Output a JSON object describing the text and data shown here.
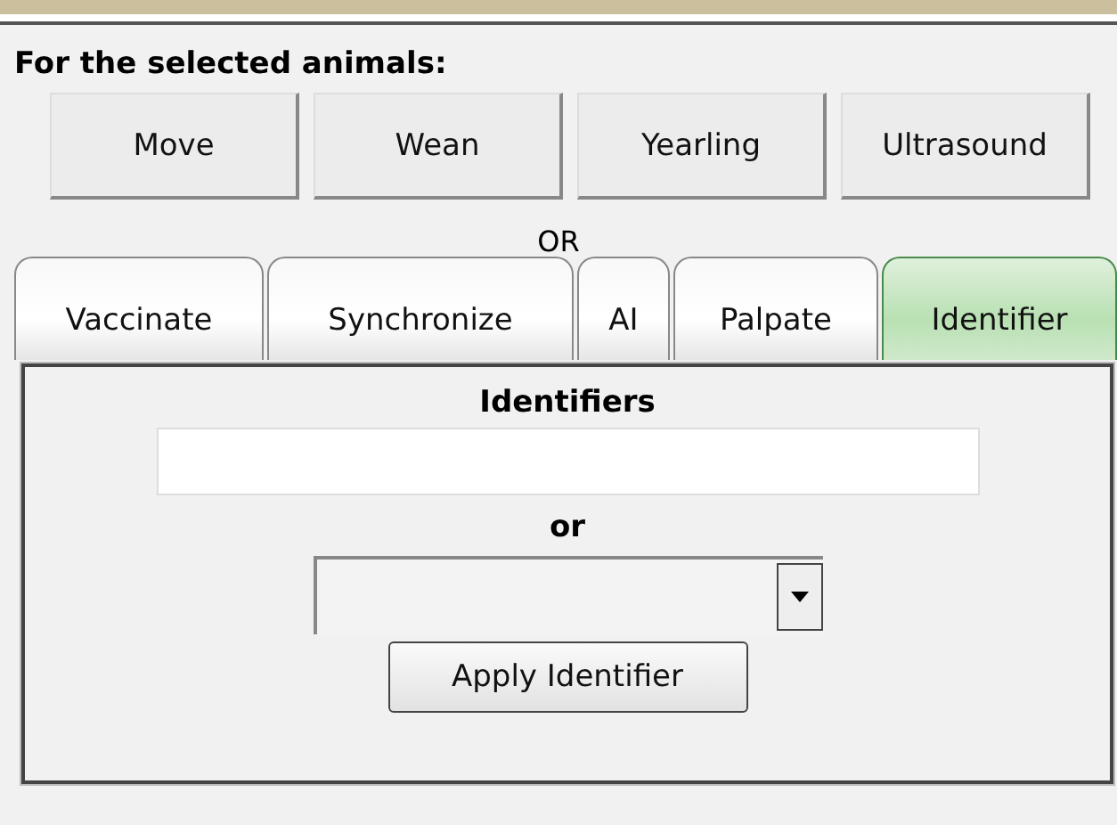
{
  "heading": "For the selected animals:",
  "actions": [
    "Move",
    "Wean",
    "Yearling",
    "Ultrasound"
  ],
  "separator": "OR",
  "tabs": [
    {
      "label": "Vaccinate",
      "selected": false
    },
    {
      "label": "Synchronize",
      "selected": false
    },
    {
      "label": "AI",
      "selected": false
    },
    {
      "label": "Palpate",
      "selected": false
    },
    {
      "label": "Identifier",
      "selected": true
    }
  ],
  "panel": {
    "title": "Identifiers",
    "or_label": "or",
    "apply_button": "Apply Identifier"
  }
}
